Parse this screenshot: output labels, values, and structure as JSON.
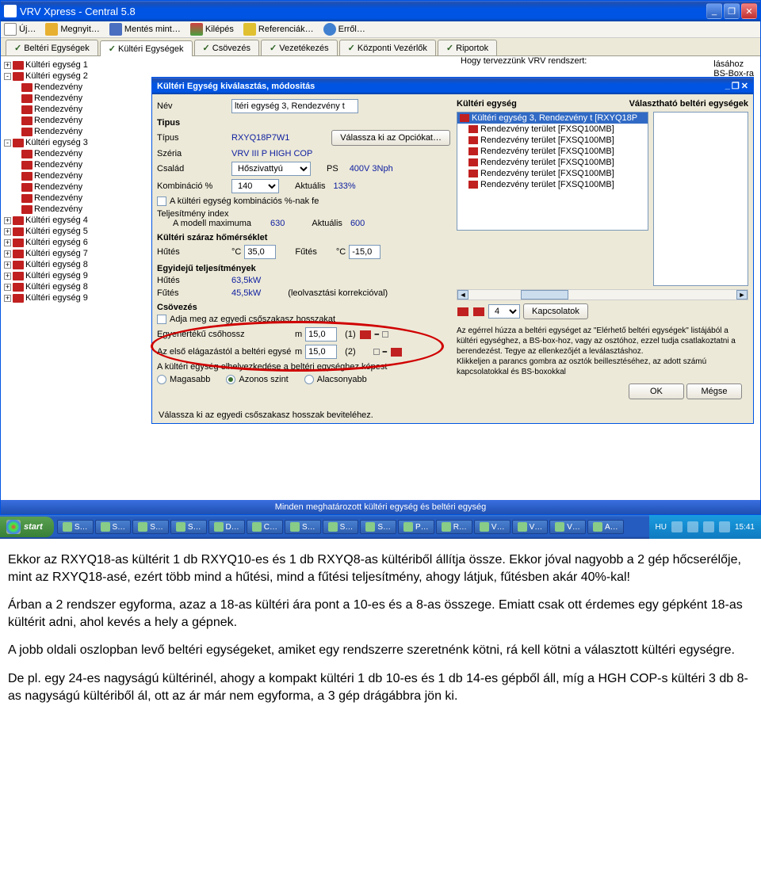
{
  "window": {
    "title": "VRV Xpress - Central 5.8"
  },
  "toolbar": {
    "new": "Új…",
    "open": "Megnyit…",
    "save": "Mentés mint…",
    "exit": "Kilépés",
    "refs": "Referenciák…",
    "about": "Erről…"
  },
  "tabs": {
    "t1": "Beltéri Egységek",
    "t2": "Kültéri Egységek",
    "t3": "Csövezés",
    "t4": "Vezetékezés",
    "t5": "Központi Vezérlők",
    "t6": "Riportok"
  },
  "info_top": "Hogy tervezzünk VRV rendszert:",
  "info_r1": "lásához",
  "info_r2": "BS-Box-ra",
  "tree": {
    "n1": "Kültéri egység 1",
    "n2": "Kültéri egység 2",
    "r1": "Rendezvény",
    "r2": "Rendezvény",
    "r3": "Rendezvény",
    "r4": "Rendezvény",
    "r5": "Rendezvény",
    "n3": "Kültéri egység 3",
    "r6": "Rendezvény",
    "r7": "Rendezvény",
    "r8": "Rendezvény",
    "r9": "Rendezvény",
    "r10": "Rendezvény",
    "r11": "Rendezvény",
    "n4": "Kültéri egység 4",
    "n5": "Kültéri egység 5",
    "n6": "Kültéri egység 6",
    "n7": "Kültéri egység 7",
    "n8": "Kültéri egység 8",
    "n9": "Kültéri egység 9",
    "n10": "Kültéri egység 8",
    "n11": "Kültéri egység 9"
  },
  "status": "Minden meghatározott kültéri egység és beltéri egység",
  "dialog": {
    "title": "Kültéri Egység kiválasztás, módositás",
    "name_lbl": "Név",
    "name_val": "ltéri egység 3, Rendezvény t",
    "type_hdr": "Tipus",
    "type_lbl": "Típus",
    "type_val": "RXYQ18P7W1",
    "opts_btn": "Válassza ki az Opciókat…",
    "series_lbl": "Széria",
    "series_val": "VRV III P HIGH COP",
    "family_lbl": "Család",
    "family_val": "Hőszivattyú",
    "ps_lbl": "PS",
    "ps_val": "400V 3Nph",
    "comb_lbl": "Kombináció %",
    "comb_val": "140",
    "act_lbl": "Aktuális",
    "act_val": "133%",
    "chk1": "A kültéri egység kombinációs %-nak fe",
    "perf_hdr": "Teljesítmény index",
    "model_lbl": "A modell maximuma",
    "model_val": "630",
    "act2_lbl": "Aktuális",
    "act2_val": "600",
    "dry_hdr": "Kültéri száraz hőmérséklet",
    "cool_lbl": "Hűtés",
    "cool_unit": "°C",
    "cool_val": "35,0",
    "heat_lbl": "Fűtés",
    "heat_unit": "°C",
    "heat_val": "-15,0",
    "sim_hdr": "Egyidejű teljesítmények",
    "sim_cool_lbl": "Hűtés",
    "sim_cool_val": "63,5kW",
    "sim_heat_lbl": "Fűtés",
    "sim_heat_val": "45,5kW",
    "sim_note": "(leolvasztási korrekcióval)",
    "pipe_hdr": "Csövezés",
    "chk2": "Adja meg az egyedi csőszakasz hosszakat",
    "eq_lbl": "Egyenértékű csőhossz",
    "eq_unit": "m",
    "eq_val": "15,0",
    "eq_n": "(1)",
    "br_lbl": "Az első elágazástól a beltéri egysé",
    "br_unit": "m",
    "br_val": "15,0",
    "br_n": "(2)",
    "pos_lbl": "A kültéri egység elhelyezkedése a beltéri egységhez képest",
    "r_high": "Magasabb",
    "r_same": "Azonos szint",
    "r_low": "Alacsonyabb",
    "right_hdr1": "Kültéri egység",
    "right_hdr2": "Választható beltéri egységek",
    "list": {
      "i0": "Kültéri egység 3, Rendezvény t [RXYQ18P",
      "i1": "Rendezvény terület [FXSQ100MB]",
      "i2": "Rendezvény terület [FXSQ100MB]",
      "i3": "Rendezvény terület [FXSQ100MB]",
      "i4": "Rendezvény terület [FXSQ100MB]",
      "i5": "Rendezvény terület [FXSQ100MB]",
      "i6": "Rendezvény terület [FXSQ100MB]"
    },
    "conn_val": "4",
    "conn_lbl": "Kapcsolatok",
    "help_text": "Az egérrel húzza a beltéri egységet az \"Elérhető beltéri egységek\" listájából a kültéri egységhez, a BS-box-hoz, vagy az osztóhoz, ezzel tudja csatlakoztatni a berendezést. Tegye az ellenkezőjét a leválasztáshoz.\nKlikkeljen a parancs gombra az osztók beillesztéséhez, az adott számú kapcsolatokkal és BS-boxokkal",
    "ok": "OK",
    "cancel": "Mégse",
    "hint": "Válassza ki az egyedi csőszakasz hosszak beviteléhez."
  },
  "taskbar": {
    "start": "start",
    "items": [
      "S…",
      "S…",
      "S…",
      "S…",
      "D…",
      "C…",
      "S…",
      "S…",
      "S…",
      "P…",
      "R…",
      "V…",
      "V…",
      "V…",
      "A…"
    ],
    "lang": "HU",
    "time": "15:41"
  },
  "doc": {
    "p1": "Ekkor az RXYQ18-as kültérit 1 db RXYQ10-es és 1 db RXYQ8-as kültériből állítja össze. Ekkor jóval nagyobb a 2 gép hőcserélője, mint az RXYQ18-asé, ezért több mind a hűtési, mind a fűtési teljesítmény, ahogy látjuk, fűtésben akár 40%-kal!",
    "p2": "Árban a 2 rendszer egyforma, azaz a 18-as kültéri ára pont a 10-es és a 8-as összege. Emiatt csak ott érdemes egy gépként 18-as kültérit adni, ahol kevés a hely a gépnek.",
    "p3": "A jobb oldali oszlopban levő beltéri egységeket, amiket egy rendszerre szeretnénk kötni, rá kell kötni a választott kültéri egységre.",
    "p4": "De pl. egy 24-es nagyságú kültérinél, ahogy a kompakt kültéri 1 db 10-es és 1 db 14-es gépből áll, míg a HGH COP-s kültéri 3 db 8-as nagyságú kültériből ál, ott az ár már nem egyforma, a 3 gép drágábbra jön ki."
  }
}
